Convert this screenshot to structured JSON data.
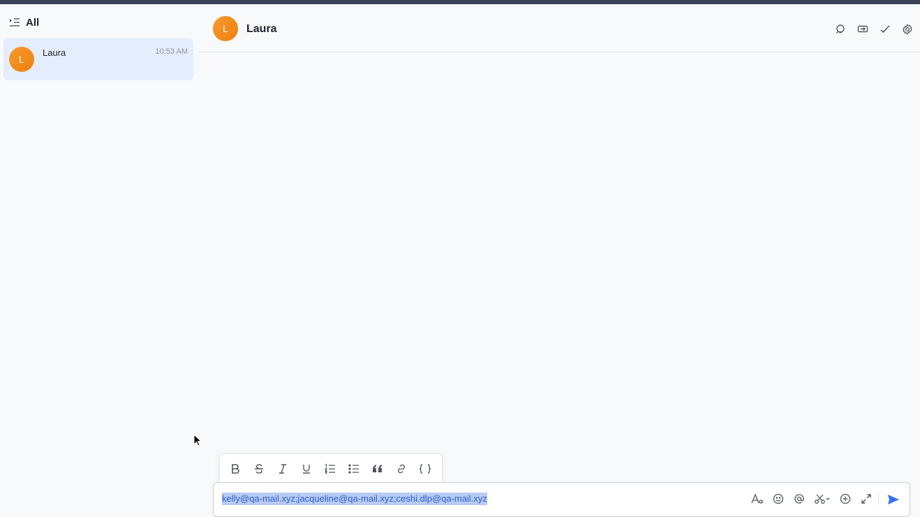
{
  "sidebar": {
    "filter_label": "All",
    "conversations": [
      {
        "initial": "L",
        "name": "Laura",
        "time": "10:53 AM"
      }
    ]
  },
  "header": {
    "initial": "L",
    "name": "Laura",
    "actions": [
      "search-icon",
      "forward-icon",
      "done-icon",
      "settings-icon"
    ]
  },
  "format_toolbar": [
    "bold-icon",
    "strikethrough-icon",
    "italic-icon",
    "underline-icon",
    "ordered-list-icon",
    "bullet-list-icon",
    "quote-icon",
    "link-icon",
    "code-block-icon"
  ],
  "composer": {
    "value": "kelly@qa-mail.xyz;jacqueline@qa-mail.xyz;ceshi.dlp@qa-mail.xyz",
    "tools": [
      "text-format-icon",
      "emoji-icon",
      "mention-icon",
      "screenshot-icon",
      "add-icon",
      "expand-icon"
    ],
    "send": "send-icon"
  },
  "colors": {
    "accent": "#3370ff",
    "avatar": "#f08a1c",
    "selected_bg": "#e4edfb",
    "selection": "#b7cbf3"
  }
}
